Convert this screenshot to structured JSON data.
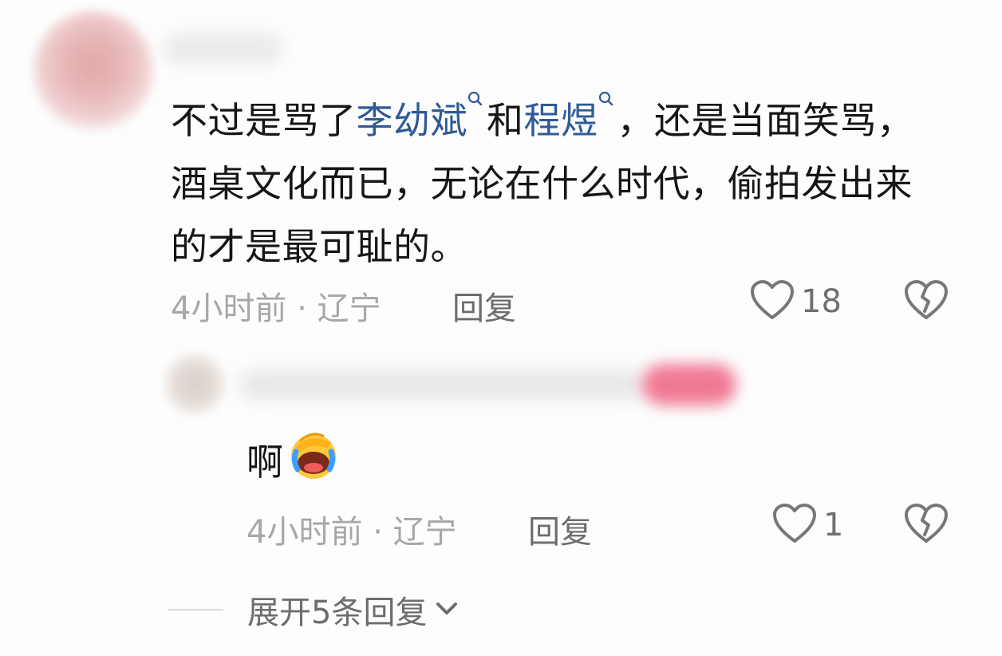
{
  "comment": {
    "text_before": "不过是骂了",
    "link1": "李幼斌",
    "middle": "和",
    "link2": "程煜",
    "text_after": "，还是当面笑骂，酒桌文化而已，无论在什么时代，偷拍发出来的才是最可耻的。",
    "time": "4小时前",
    "dot": "·",
    "location": "辽宁",
    "reply_label": "回复",
    "like_count": "18"
  },
  "reply": {
    "text": "啊",
    "emoji_icon": "facepalm-crying-emoji",
    "time": "4小时前",
    "dot": "·",
    "location": "辽宁",
    "reply_label": "回复",
    "like_count": "1"
  },
  "expand": {
    "label": "展开5条回复"
  },
  "colors": {
    "link": "#2f5a97",
    "text": "#161616",
    "meta": "#a7a7a7",
    "action": "#6d6d6d"
  }
}
